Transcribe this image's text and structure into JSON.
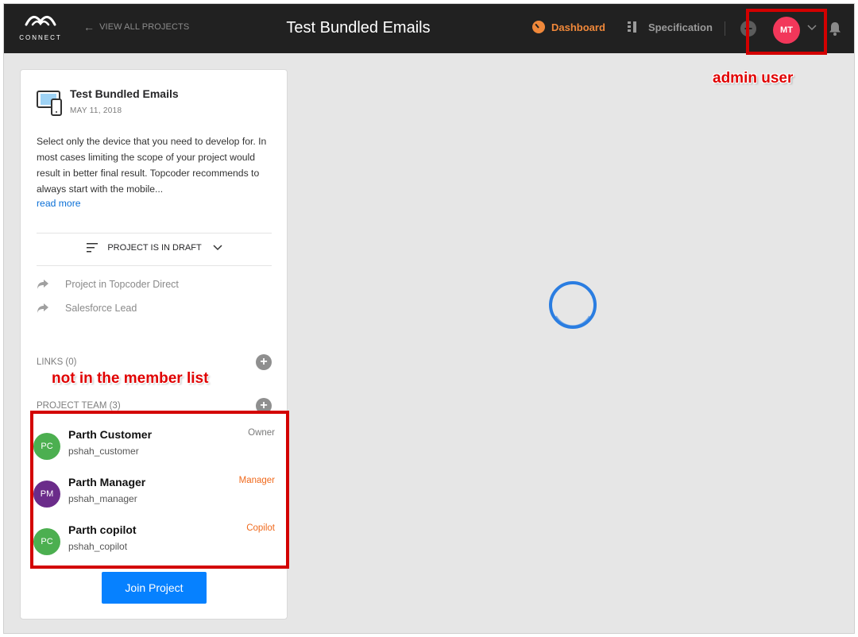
{
  "header": {
    "logo_text": "CONNECT",
    "back_link": "VIEW ALL PROJECTS",
    "title": "Test Bundled Emails",
    "nav": {
      "dashboard": "Dashboard",
      "specification": "Specification"
    },
    "user_initials": "MT",
    "icons": [
      "logo-icon",
      "arrow-left-icon",
      "dashboard-icon",
      "specification-icon",
      "plus-circle-icon",
      "chevron-down-icon",
      "bell-icon"
    ]
  },
  "annotations": {
    "admin_user": "admin user",
    "not_in_member_list": "not in the member list"
  },
  "project": {
    "title": "Test Bundled Emails",
    "date": "MAY 11, 2018",
    "description": "Select only the device that you need to develop for. In most cases limiting the scope of your project would result in better final result. Topcoder recommends to always start with the mobile...",
    "read_more": "read more",
    "status": "PROJECT IS IN DRAFT",
    "external_links": [
      {
        "label": "Project in Topcoder Direct"
      },
      {
        "label": "Salesforce Lead"
      }
    ],
    "links_heading": "LINKS (0)",
    "team_heading": "PROJECT TEAM (3)",
    "team": [
      {
        "initials": "PC",
        "name": "Parth Customer",
        "handle": "pshah_customer",
        "role": "Owner",
        "avatar_color": "#4caf50",
        "role_color": "#7a7a7a"
      },
      {
        "initials": "PM",
        "name": "Parth Manager",
        "handle": "pshah_manager",
        "role": "Manager",
        "avatar_color": "#6b2c8a",
        "role_color": "#f06a1d"
      },
      {
        "initials": "PC",
        "name": "Parth copilot",
        "handle": "pshah_copilot",
        "role": "Copilot",
        "avatar_color": "#4caf50",
        "role_color": "#f06a1d"
      }
    ],
    "join_button": "Join Project"
  },
  "colors": {
    "accent": "#f0883a",
    "primary_button": "#0681ff",
    "annotation_red": "#d30000"
  }
}
